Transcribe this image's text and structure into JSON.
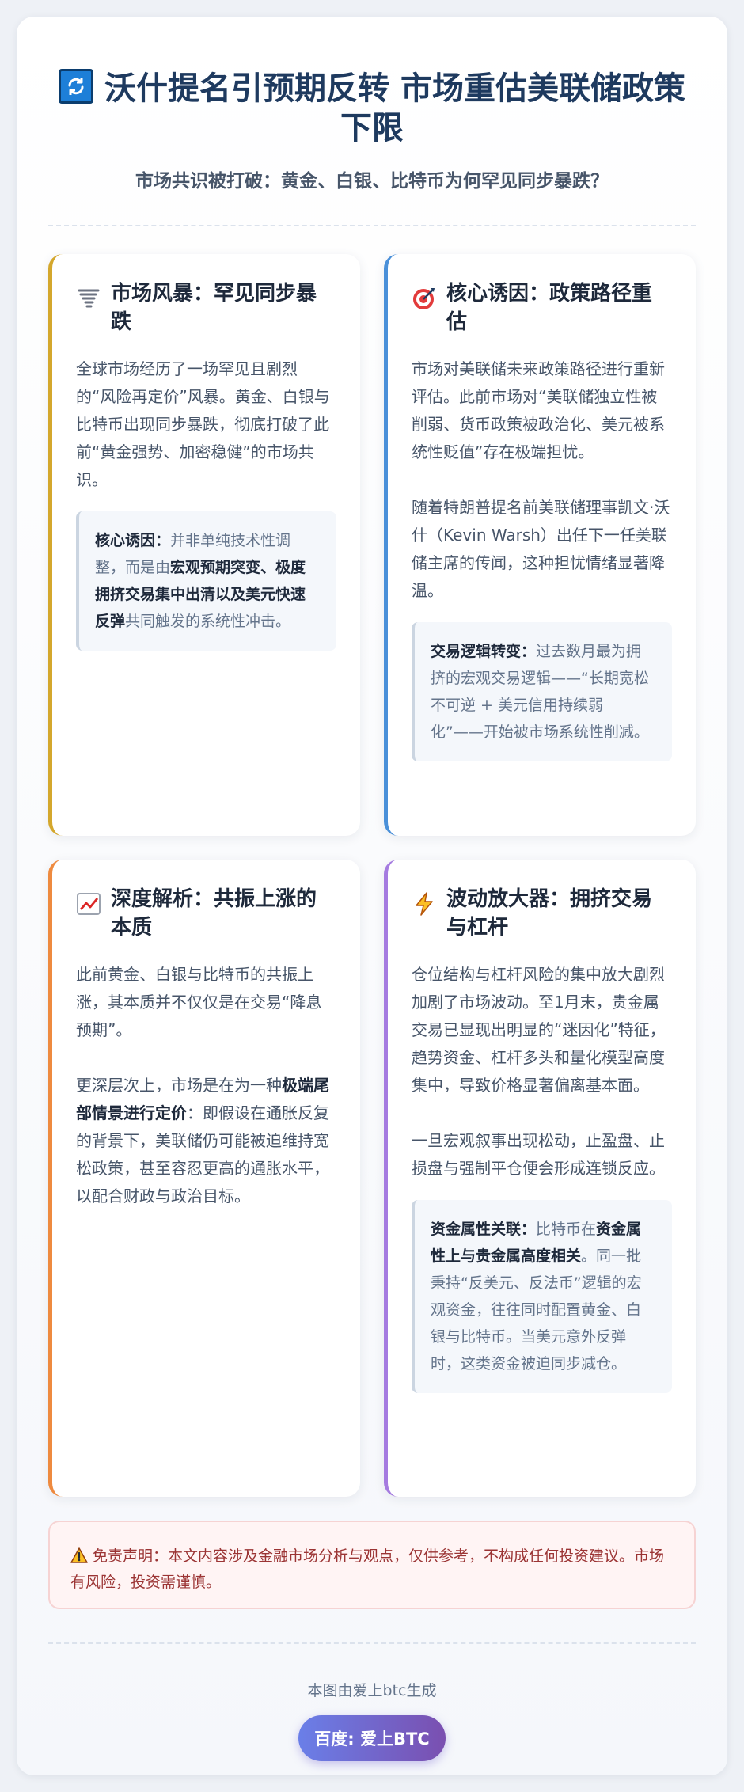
{
  "header": {
    "title": "沃什提名引预期反转 市场重估美联储政策下限",
    "subtitle": "市场共识被打破：黄金、白银、比特币为何罕见同步暴跌？"
  },
  "cards": [
    {
      "title": "市场风暴：罕见同步暴跌",
      "icon": "tornado-icon",
      "accent": "#d4a72c",
      "p1": "全球市场经历了一场罕见且剧烈的“风险再定价”风暴。黄金、白银与比特币出现同步暴跌，彻底打破了此前“黄金强势、加密稳健”的市场共识。",
      "quote_label": "核心诱因：",
      "quote_a": "并非单纯技术性调整，而是由",
      "quote_bold": "宏观预期突变、极度拥挤交易集中出清以及美元快速反弹",
      "quote_b": "共同触发的系统性冲击。"
    },
    {
      "title": "核心诱因：政策路径重估",
      "icon": "target-icon",
      "accent": "#4a90d9",
      "p1": "市场对美联储未来政策路径进行重新评估。此前市场对“美联储独立性被削弱、货币政策被政治化、美元被系统性贬值”存在极端担忧。",
      "p2": "随着特朗普提名前美联储理事凯文·沃什（Kevin Warsh）出任下一任美联储主席的传闻，这种担忧情绪显著降温。",
      "quote_label": "交易逻辑转变：",
      "quote_a": "过去数月最为拥挤的宏观交易逻辑——“长期宽松不可逆 + 美元信用持续弱化”——开始被市场系统性削减。"
    },
    {
      "title": "深度解析：共振上涨的本质",
      "icon": "chart-up-icon",
      "accent": "#ee8a3f",
      "p1": "此前黄金、白银与比特币的共振上涨，其本质并不仅仅是在交易“降息预期”。",
      "p2_a": "更深层次上，市场是在为一种",
      "p2_bold": "极端尾部情景进行定价",
      "p2_b": "：即假设在通胀反复的背景下，美联储仍可能被迫维持宽松政策，甚至容忍更高的通胀水平，以配合财政与政治目标。"
    },
    {
      "title": "波动放大器：拥挤交易与杠杆",
      "icon": "lightning-icon",
      "accent": "#a57be0",
      "p1": "仓位结构与杠杆风险的集中放大剧烈加剧了市场波动。至1月末，贵金属交易已显现出明显的“迷因化”特征，趋势资金、杠杆多头和量化模型高度集中，导致价格显著偏离基本面。",
      "p2": "一旦宏观叙事出现松动，止盈盘、止损盘与强制平仓便会形成连锁反应。",
      "quote_label": "资金属性关联：",
      "quote_a": "比特币在",
      "quote_bold": "资金属性上与贵金属高度相关",
      "quote_b": "。同一批秉持“反美元、反法币”逻辑的宏观资金，往往同时配置黄金、白银与比特币。当美元意外反弹时，这类资金被迫同步减仓。"
    }
  ],
  "disclaimer": "免责声明：本文内容涉及金融市场分析与观点，仅供参考，不构成任何投资建议。市场有风险，投资需谨慎。",
  "footer": {
    "generated_by": "本图由爱上btc生成",
    "badge": "百度: 爱上BTC"
  }
}
